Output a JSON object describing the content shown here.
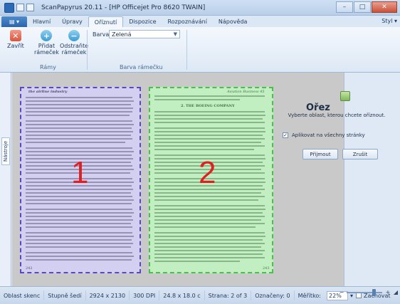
{
  "window": {
    "title": "ScanPapyrus 20.11 - [HP Officejet Pro 8620 TWAIN]",
    "minimize": "–",
    "maximize": "□",
    "close": "✕"
  },
  "ribbon_tabs": [
    "Hlavní",
    "Úpravy",
    "Oříznutí",
    "Dispozice",
    "Rozpoznávání",
    "Nápověda"
  ],
  "active_tab_index": 2,
  "style_menu": "Styl",
  "ribbon": {
    "close_label": "Zavřít",
    "add_label_1": "Přidat",
    "add_label_2": "rámeček",
    "remove_label_1": "Odstraňte",
    "remove_label_2": "rámeček",
    "group_frames": "Rámy",
    "color_label": "Barva:",
    "color_value": "Zelená",
    "group_color": "Barva rámečku"
  },
  "side_panel": {
    "label": "Nástroje"
  },
  "pages": {
    "left_number": "1",
    "right_number": "2",
    "left_heading": "the airline industry",
    "right_header": "Aviation Business 45",
    "right_heading": "2. THE BOEING COMPANY",
    "left_page_no": "242",
    "right_page_no": "243"
  },
  "crop_panel": {
    "title": "Ořez",
    "description": "Vyberte oblast, kterou chcete oříznout.",
    "apply_all_label": "Aplikovat na všechny stránky",
    "apply_all_checked": "✓",
    "accept_label": "Přijmout",
    "cancel_label": "Zrušit"
  },
  "status": {
    "scan_area": "Oblast skenc",
    "gray": "Stupně šedí",
    "dimensions": "2924 x 2130",
    "dpi": "300 DPI",
    "size": "24.8 x 18.0 c",
    "page": "Strana: 2 of 3",
    "marked": "Označeny: 0",
    "scale_label": "Měřítko:",
    "zoom": "22%",
    "zoom_arrow": "▾",
    "save_label": "Zachovat"
  },
  "colors": {
    "crop_left": "#5a48c2",
    "crop_right": "#4bbf4b",
    "number": "#e02020"
  }
}
